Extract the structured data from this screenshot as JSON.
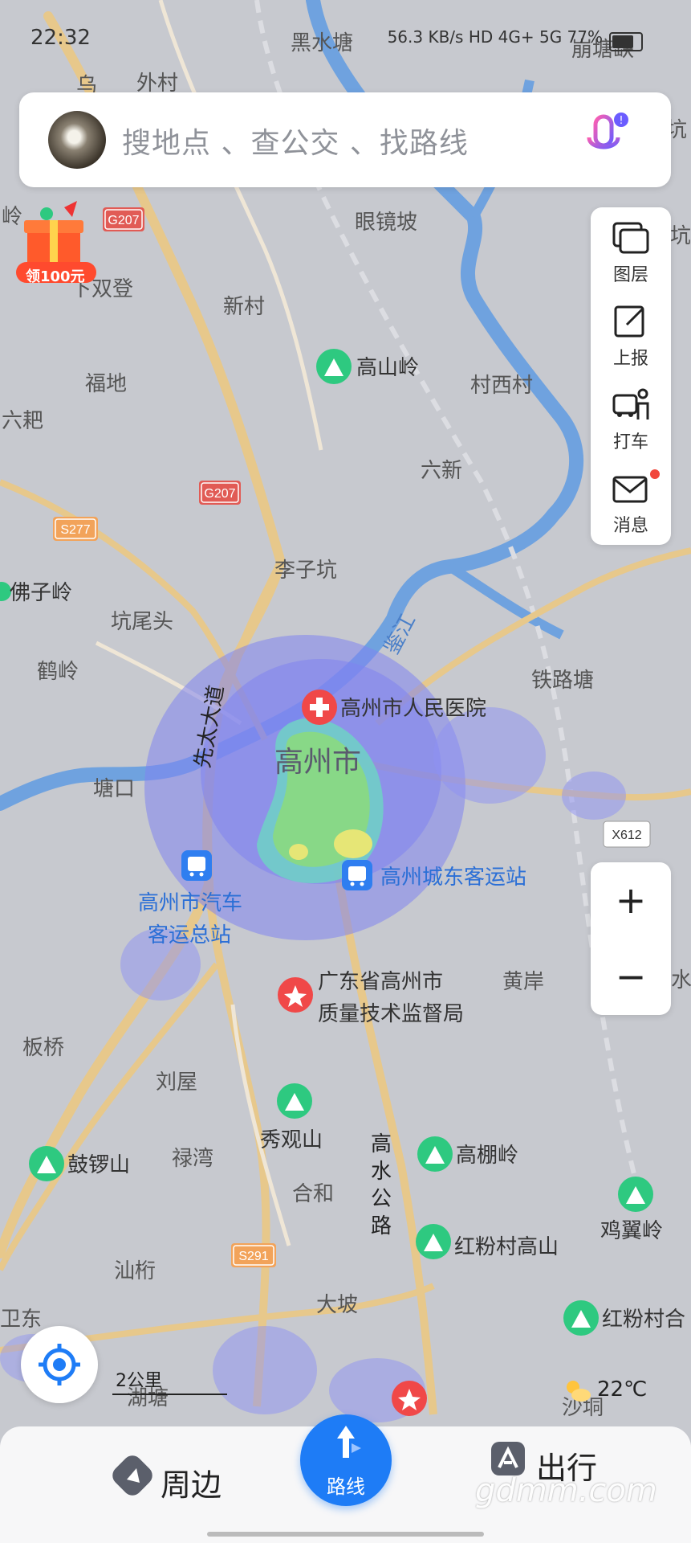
{
  "status": {
    "time": "22:32",
    "net_speed": "56.3 KB/s",
    "indicators": "HD 4G+ 5G",
    "battery": "77%"
  },
  "search": {
    "placeholder": "搜地点 、查公交 、找路线"
  },
  "gift": {
    "label": "领100元"
  },
  "tools": {
    "layers": "图层",
    "report": "上报",
    "taxi": "打车",
    "messages": "消息"
  },
  "zoom": {
    "in": "+",
    "out": "−"
  },
  "scale": {
    "label": "2公里"
  },
  "weather": {
    "temp": "22℃"
  },
  "bottom": {
    "nearby": "周边",
    "route": "路线",
    "travel": "出行"
  },
  "watermark": "gdmm.com",
  "map": {
    "city": "高州市",
    "river": "鉴江",
    "roads": [
      "先太大道",
      "高水公路"
    ],
    "shields": [
      "G207",
      "G207",
      "S277",
      "S291",
      "X612"
    ],
    "places": [
      "乌",
      "外村",
      "黑水塘",
      "崩塘缺",
      "眼镜坡",
      "新村",
      "下双登",
      "福地",
      "六耙",
      "村西村",
      "六新",
      "李子坑",
      "坑尾头",
      "鹤岭",
      "铁路塘",
      "塘口",
      "黄岸",
      "板桥",
      "刘屋",
      "禄湾",
      "合和",
      "汕桁",
      "大坡",
      "卫东",
      "湖塘",
      "沙垌",
      "岭",
      "坑",
      "坑",
      "水"
    ],
    "mountains": [
      "高山岭",
      "佛子岭",
      "秀观山",
      "鼓锣山",
      "高棚岭",
      "红粉村高山",
      "鸡翼岭",
      "红粉村合"
    ],
    "pois": {
      "hospital": "高州市人民医院",
      "bus_east": "高州城东客运站",
      "bus_main_1": "高州市汽车",
      "bus_main_2": "客运总站",
      "bureau_1": "广东省高州市",
      "bureau_2": "质量技术监督局"
    }
  },
  "colors": {
    "accent": "#1e7cf6",
    "map_bg": "#c7c9cf",
    "river": "#6fa2df",
    "road": "#e7c88b",
    "heat_outer": "#7f83f0",
    "heat_inner": "#88d887"
  }
}
